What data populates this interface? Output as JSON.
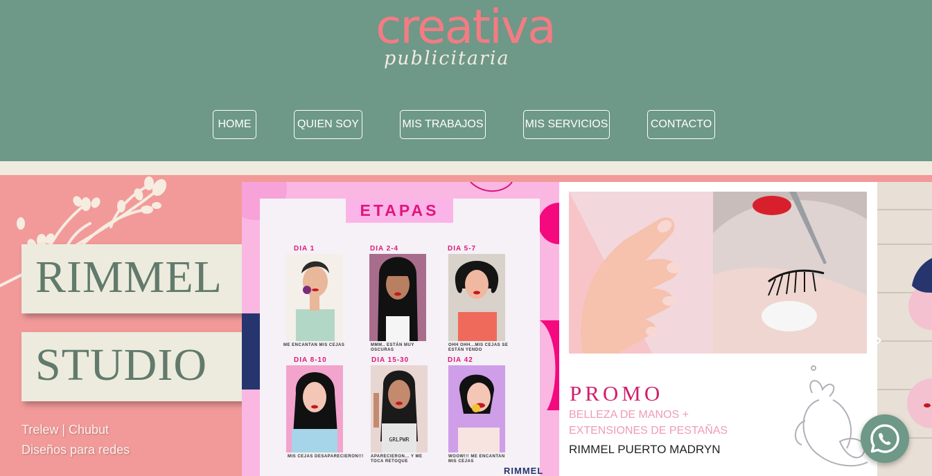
{
  "logo": {
    "main": "creativa",
    "sub": "publicitaria"
  },
  "nav": [
    {
      "label": "HOME"
    },
    {
      "label": "QUIEN SOY"
    },
    {
      "label": "MIS TRABAJOS"
    },
    {
      "label": "MIS SERVICIOS"
    },
    {
      "label": "CONTACTO"
    }
  ],
  "hero": {
    "title_line1": "RIMMEL",
    "title_line2": "STUDIO",
    "location": "Trelew | Chubut",
    "tagline": "Diseños para redes"
  },
  "etapas": {
    "title": "ETAPAS",
    "days": [
      {
        "label": "DIA 1",
        "caption": "ME ENCANTAN MIS CEJAS"
      },
      {
        "label": "DIA 2-4",
        "caption": "MMM.. ESTÁN MUY OSCURAS"
      },
      {
        "label": "DIA 5-7",
        "caption": "OHH OHH...MIS CEJAS SE ESTÁN YENDO"
      },
      {
        "label": "DIA 8-10",
        "caption": "MIS CEJAS DESAPARECIERON!!!"
      },
      {
        "label": "DIA 15-30",
        "caption": "APARECIERON... Y ME TOCA RETOQUE"
      },
      {
        "label": "DIA 42",
        "caption": "WOOW!!! ME ENCANTAN MIS CEJAS"
      }
    ],
    "shirt_text": "GRLPWR",
    "footer_brand": "RIMMEL"
  },
  "promo": {
    "title": "PROMO",
    "line1": "BELLEZA DE MANOS +",
    "line2": "EXTENSIONES DE PESTAÑAS",
    "brand": "RIMMEL PUERTO MADRYN"
  },
  "colors": {
    "header_bg": "#6e9888",
    "hero_bg": "#f29a99",
    "logo_coral": "#f27c83",
    "title_green": "#617a6c",
    "promo_magenta": "#d01f6e"
  },
  "icons": [
    "whatsapp-icon",
    "chevron-right-icon",
    "branch-decoration"
  ]
}
